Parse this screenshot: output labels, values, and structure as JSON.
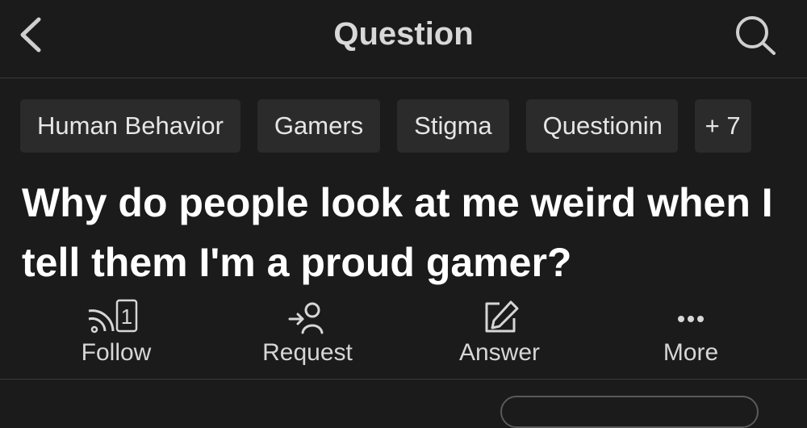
{
  "header": {
    "title": "Question"
  },
  "topics": [
    {
      "label": "Human Behavior"
    },
    {
      "label": "Gamers"
    },
    {
      "label": "Stigma"
    },
    {
      "label": "Questionin"
    },
    {
      "label": "+ 7"
    }
  ],
  "question": {
    "text": "Why do people look at me weird when I tell them I'm a proud gamer?"
  },
  "actions": {
    "follow": {
      "label": "Follow",
      "count": "1"
    },
    "request": {
      "label": "Request"
    },
    "answer": {
      "label": "Answer"
    },
    "more": {
      "label": "More"
    }
  },
  "colors": {
    "background": "#1b1b1b",
    "chip": "#2b2b2b",
    "text": "#ffffff",
    "muted": "#d6d6d6"
  },
  "icons": [
    "chevron-left-icon",
    "search-icon",
    "rss-follow-icon",
    "request-person-icon",
    "edit-pencil-icon",
    "ellipsis-icon"
  ]
}
